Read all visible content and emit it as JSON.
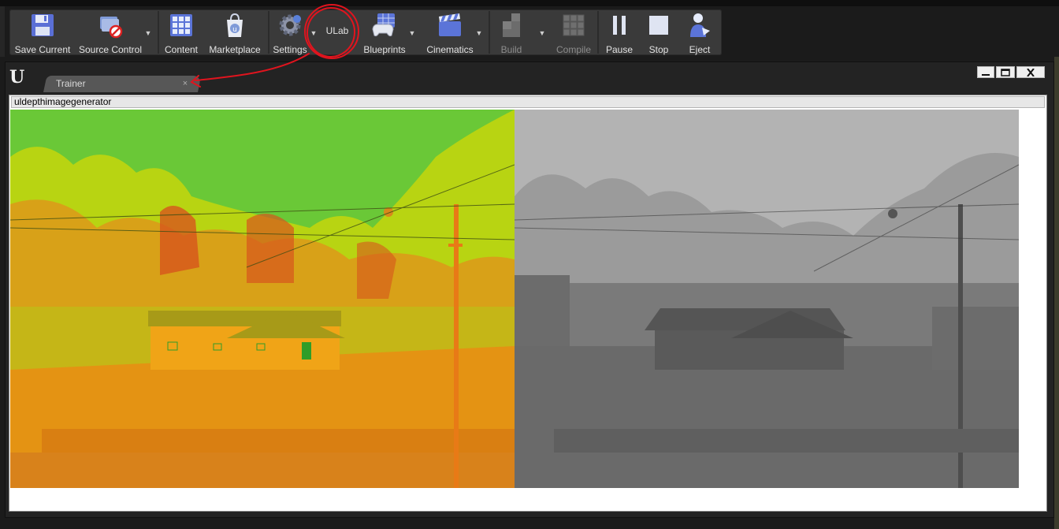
{
  "toolbar": {
    "buttons": [
      {
        "label": "Save Current",
        "icon": "save-icon"
      },
      {
        "label": "Source Control",
        "icon": "source-control-icon"
      },
      {
        "label": "Content",
        "icon": "content-browser-icon"
      },
      {
        "label": "Marketplace",
        "icon": "marketplace-icon"
      },
      {
        "label": "Settings",
        "icon": "settings-gear-icon"
      },
      {
        "label": "ULab",
        "icon": ""
      },
      {
        "label": "Blueprints",
        "icon": "blueprints-gamepad-icon"
      },
      {
        "label": "Cinematics",
        "icon": "cinematics-clapper-icon"
      },
      {
        "label": "Build",
        "icon": "build-blocks-icon"
      },
      {
        "label": "Compile",
        "icon": "compile-cube-icon"
      },
      {
        "label": "Pause",
        "icon": "pause-icon"
      },
      {
        "label": "Stop",
        "icon": "stop-icon"
      },
      {
        "label": "Eject",
        "icon": "eject-person-icon"
      }
    ]
  },
  "window": {
    "tab_label": "Trainer",
    "tab_close": "×",
    "address": "uldepthimagegenerator",
    "images": [
      {
        "name": "color-segmentation-view",
        "palette": [
          "#6ac837",
          "#b8d412",
          "#e49313",
          "#d7551d",
          "#f0a417"
        ]
      },
      {
        "name": "depth-view",
        "palette": [
          "#b3b3b3",
          "#9b9b9b",
          "#7a7a7a",
          "#6a6a6a",
          "#4e4e4e"
        ]
      }
    ]
  },
  "annotation": {
    "color": "#e0141e"
  }
}
